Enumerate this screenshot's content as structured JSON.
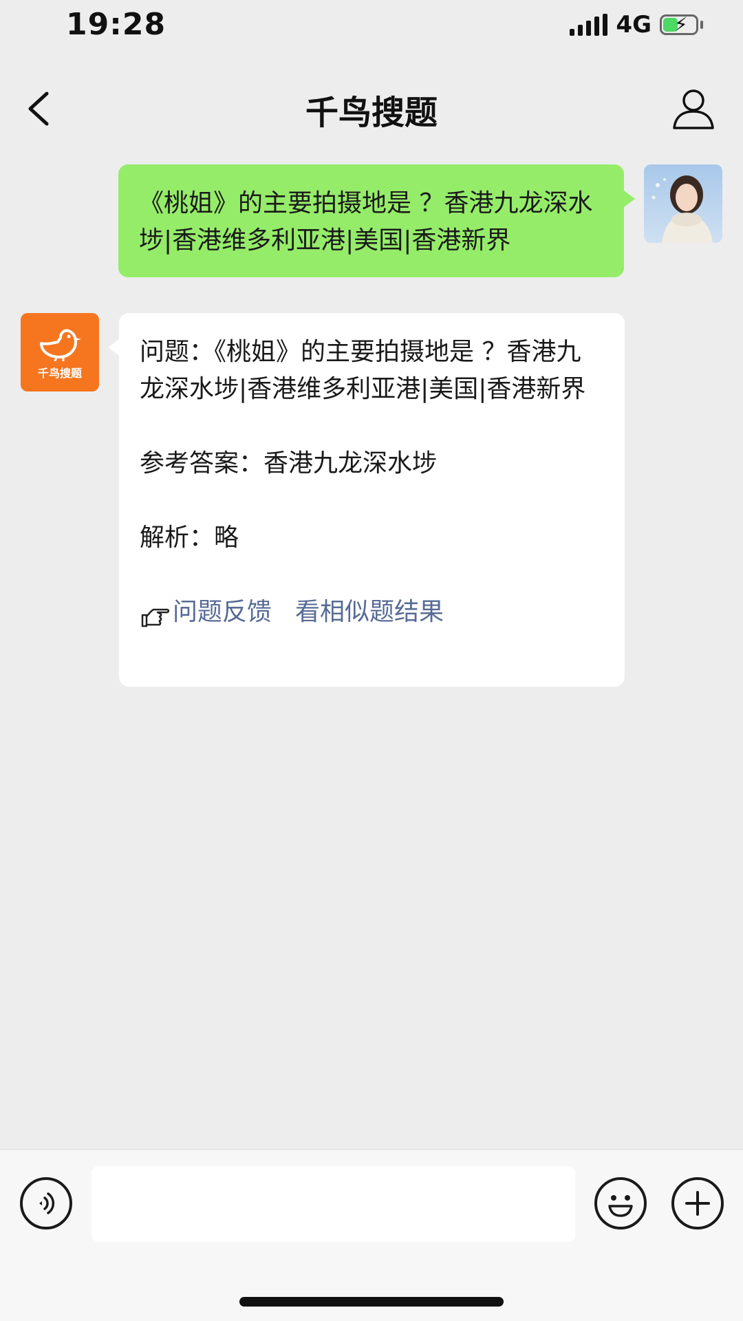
{
  "status_bar": {
    "time": "19:28",
    "network": "4G",
    "charging": true
  },
  "nav": {
    "title": "千鸟搜题"
  },
  "chat": {
    "user_message": "《桃姐》的主要拍摄地是 ？香港九龙深水埗|香港维多利亚港|美国|香港新界",
    "bot_avatar_label": "千鸟搜题",
    "bot_reply": {
      "question_label": "问题：",
      "question_text": "《桃姐》的主要拍摄地是 ？香港九龙深水埗|香港维多利亚港|美国|香港新界",
      "answer_label": "参考答案：",
      "answer_text": "香港九龙深水埗",
      "analysis_label": "解析：",
      "analysis_text": "略",
      "feedback_link": "问题反馈",
      "similar_link": "看相似题结果"
    }
  },
  "input_bar": {
    "value": ""
  },
  "colors": {
    "user_bubble": "#95ec69",
    "bot_bubble": "#ffffff",
    "link": "#576b95",
    "brand_orange": "#f5761f",
    "background": "#ededed"
  },
  "icons": {
    "back": "chevron-left-icon",
    "profile": "person-icon",
    "voice": "voice-icon",
    "emoji": "smiley-icon",
    "plus": "plus-icon",
    "hand": "pointing-hand-icon"
  }
}
